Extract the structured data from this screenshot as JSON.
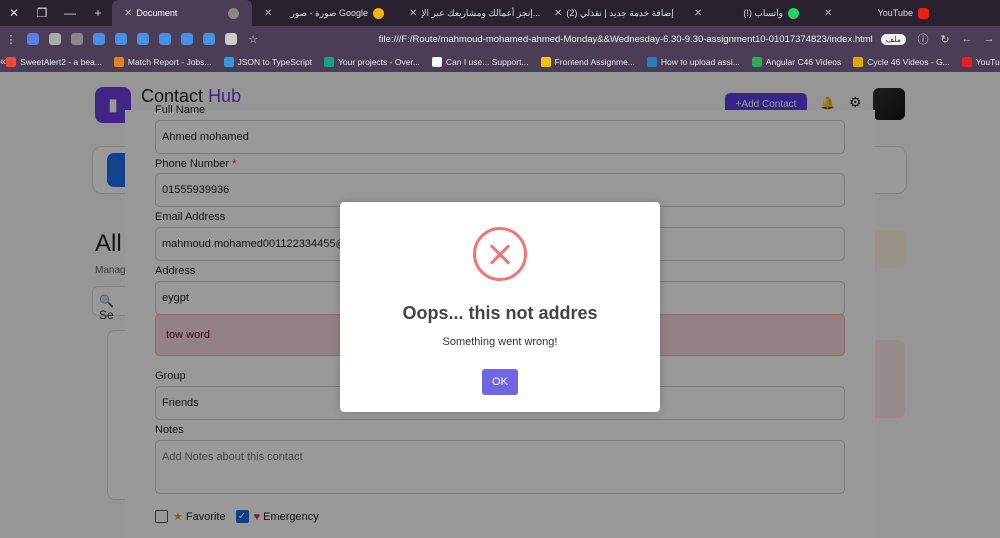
{
  "browser": {
    "tabs": [
      {
        "label": "Document",
        "active": true
      },
      {
        "label": "صورة - صور Google"
      },
      {
        "label": "إنجز أعمالك ومشاريعك عبر الإ..."
      },
      {
        "label": "(2) إضافة خدمة جديد | نقذلي"
      },
      {
        "label": "(!) واتساب"
      },
      {
        "label": "YouTube"
      }
    ],
    "new_tab": "+",
    "url": "file:///F:/Route/mahmoud-mohamed-ahmed-Monday&&Wednesday-6.30-9.30-assignment10-01017374823/index.html",
    "url_badge": "ملف",
    "bookmarks": [
      "SweetAlert2 - a bea...",
      "Match Report - Jobs...",
      "JSON to TypeScript",
      "Your projects - Over...",
      "Can I use... Support...",
      "Frontend Assignme...",
      "How to upload assi...",
      "Angular C46 Videos",
      "Cycle 46 Videos - G...",
      "YouTube"
    ]
  },
  "app": {
    "brand_main": "Contact",
    "brand_accent": "Hub",
    "add_contact": "+Add Contact",
    "bg_heading": "All",
    "bg_sub": "Manag",
    "bg_search": "Se"
  },
  "form": {
    "name_label": "Full Name",
    "name_value": "Ahmed mohamed",
    "phone_label": "Phone Number",
    "required_mark": "*",
    "phone_value": "01555939936",
    "email_label": "Email Address",
    "email_value": "mahmoud.mohamed001122334455@gm",
    "address_label": "Address",
    "address_value": "eygpt",
    "address_error": "tow word",
    "group_label": "Group",
    "group_value": "Friends",
    "notes_label": "Notes",
    "notes_placeholder": "Add Notes about  this contact",
    "favorite_label": "Favorite",
    "emergency_label": "Emergency"
  },
  "dialog": {
    "title": "Oops... this not addres",
    "text": "Something went wrong!",
    "ok": "OK"
  },
  "colors": {
    "accent": "#6b3fe0",
    "error": "#f27474",
    "ok_button": "#7066e0"
  }
}
